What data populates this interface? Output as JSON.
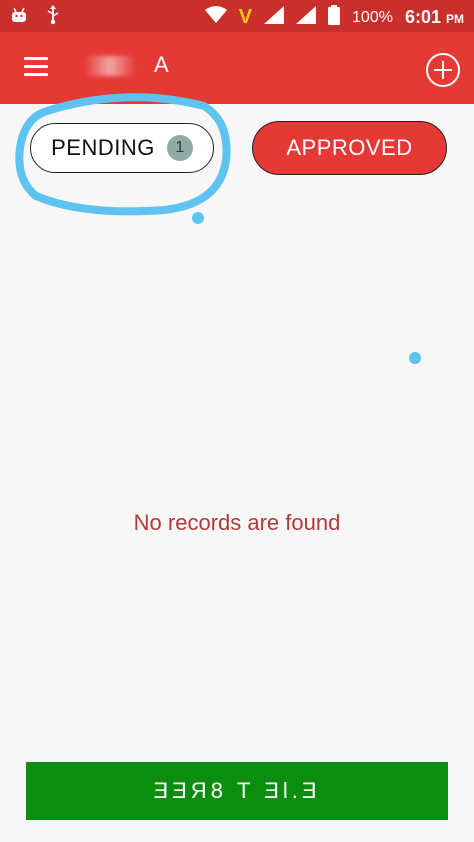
{
  "status_bar": {
    "battery": "100%",
    "time": "6:01",
    "ampm": "PM",
    "carrier_icon": "V"
  },
  "app_bar": {
    "title": "A"
  },
  "tabs": {
    "pending_label": "PENDING",
    "pending_count": "1",
    "approved_label": "APPROVED"
  },
  "main": {
    "empty_message": "No records are found"
  },
  "bottom": {
    "button_label": "ƎƎЯ8 T ƎƖ.Ǝ"
  },
  "colors": {
    "status_bar": "#c9302c",
    "app_bar": "#e53935",
    "approved": "#e53935",
    "bottom_button": "#0b8e10",
    "annotation": "#5ec3ee",
    "empty_text": "#b23a3a"
  }
}
